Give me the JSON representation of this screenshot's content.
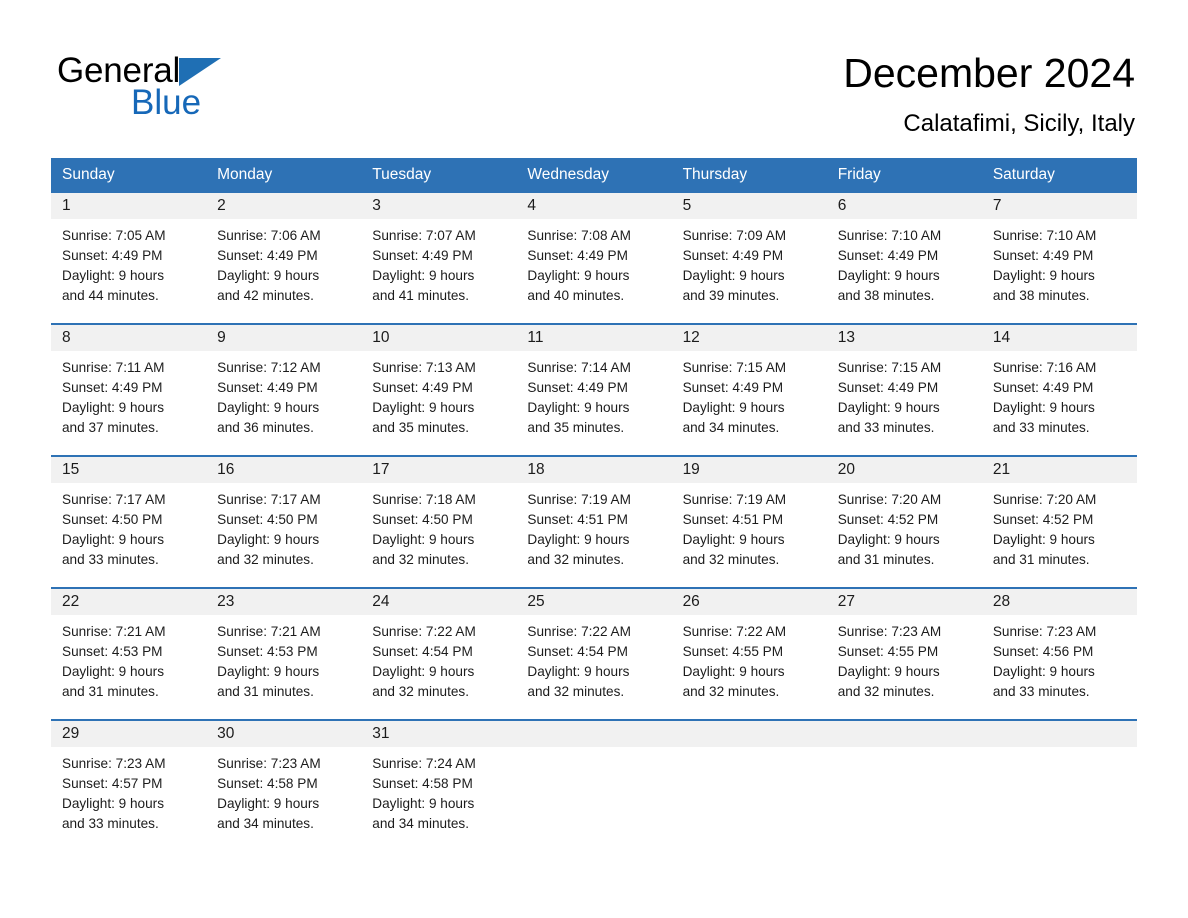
{
  "brand": {
    "name_part1": "General",
    "name_part2": "Blue",
    "accent_color": "#1668b8",
    "triangle_color": "#1f6fb4"
  },
  "header": {
    "title": "December 2024",
    "subtitle": "Calatafimi, Sicily, Italy",
    "header_bg_color": "#2e72b5",
    "day_band_color": "#f1f1f1"
  },
  "weekdays": [
    "Sunday",
    "Monday",
    "Tuesday",
    "Wednesday",
    "Thursday",
    "Friday",
    "Saturday"
  ],
  "weeks": [
    [
      {
        "day": "1",
        "sunrise": "Sunrise: 7:05 AM",
        "sunset": "Sunset: 4:49 PM",
        "daylight_line1": "Daylight: 9 hours",
        "daylight_line2": "and 44 minutes."
      },
      {
        "day": "2",
        "sunrise": "Sunrise: 7:06 AM",
        "sunset": "Sunset: 4:49 PM",
        "daylight_line1": "Daylight: 9 hours",
        "daylight_line2": "and 42 minutes."
      },
      {
        "day": "3",
        "sunrise": "Sunrise: 7:07 AM",
        "sunset": "Sunset: 4:49 PM",
        "daylight_line1": "Daylight: 9 hours",
        "daylight_line2": "and 41 minutes."
      },
      {
        "day": "4",
        "sunrise": "Sunrise: 7:08 AM",
        "sunset": "Sunset: 4:49 PM",
        "daylight_line1": "Daylight: 9 hours",
        "daylight_line2": "and 40 minutes."
      },
      {
        "day": "5",
        "sunrise": "Sunrise: 7:09 AM",
        "sunset": "Sunset: 4:49 PM",
        "daylight_line1": "Daylight: 9 hours",
        "daylight_line2": "and 39 minutes."
      },
      {
        "day": "6",
        "sunrise": "Sunrise: 7:10 AM",
        "sunset": "Sunset: 4:49 PM",
        "daylight_line1": "Daylight: 9 hours",
        "daylight_line2": "and 38 minutes."
      },
      {
        "day": "7",
        "sunrise": "Sunrise: 7:10 AM",
        "sunset": "Sunset: 4:49 PM",
        "daylight_line1": "Daylight: 9 hours",
        "daylight_line2": "and 38 minutes."
      }
    ],
    [
      {
        "day": "8",
        "sunrise": "Sunrise: 7:11 AM",
        "sunset": "Sunset: 4:49 PM",
        "daylight_line1": "Daylight: 9 hours",
        "daylight_line2": "and 37 minutes."
      },
      {
        "day": "9",
        "sunrise": "Sunrise: 7:12 AM",
        "sunset": "Sunset: 4:49 PM",
        "daylight_line1": "Daylight: 9 hours",
        "daylight_line2": "and 36 minutes."
      },
      {
        "day": "10",
        "sunrise": "Sunrise: 7:13 AM",
        "sunset": "Sunset: 4:49 PM",
        "daylight_line1": "Daylight: 9 hours",
        "daylight_line2": "and 35 minutes."
      },
      {
        "day": "11",
        "sunrise": "Sunrise: 7:14 AM",
        "sunset": "Sunset: 4:49 PM",
        "daylight_line1": "Daylight: 9 hours",
        "daylight_line2": "and 35 minutes."
      },
      {
        "day": "12",
        "sunrise": "Sunrise: 7:15 AM",
        "sunset": "Sunset: 4:49 PM",
        "daylight_line1": "Daylight: 9 hours",
        "daylight_line2": "and 34 minutes."
      },
      {
        "day": "13",
        "sunrise": "Sunrise: 7:15 AM",
        "sunset": "Sunset: 4:49 PM",
        "daylight_line1": "Daylight: 9 hours",
        "daylight_line2": "and 33 minutes."
      },
      {
        "day": "14",
        "sunrise": "Sunrise: 7:16 AM",
        "sunset": "Sunset: 4:49 PM",
        "daylight_line1": "Daylight: 9 hours",
        "daylight_line2": "and 33 minutes."
      }
    ],
    [
      {
        "day": "15",
        "sunrise": "Sunrise: 7:17 AM",
        "sunset": "Sunset: 4:50 PM",
        "daylight_line1": "Daylight: 9 hours",
        "daylight_line2": "and 33 minutes."
      },
      {
        "day": "16",
        "sunrise": "Sunrise: 7:17 AM",
        "sunset": "Sunset: 4:50 PM",
        "daylight_line1": "Daylight: 9 hours",
        "daylight_line2": "and 32 minutes."
      },
      {
        "day": "17",
        "sunrise": "Sunrise: 7:18 AM",
        "sunset": "Sunset: 4:50 PM",
        "daylight_line1": "Daylight: 9 hours",
        "daylight_line2": "and 32 minutes."
      },
      {
        "day": "18",
        "sunrise": "Sunrise: 7:19 AM",
        "sunset": "Sunset: 4:51 PM",
        "daylight_line1": "Daylight: 9 hours",
        "daylight_line2": "and 32 minutes."
      },
      {
        "day": "19",
        "sunrise": "Sunrise: 7:19 AM",
        "sunset": "Sunset: 4:51 PM",
        "daylight_line1": "Daylight: 9 hours",
        "daylight_line2": "and 32 minutes."
      },
      {
        "day": "20",
        "sunrise": "Sunrise: 7:20 AM",
        "sunset": "Sunset: 4:52 PM",
        "daylight_line1": "Daylight: 9 hours",
        "daylight_line2": "and 31 minutes."
      },
      {
        "day": "21",
        "sunrise": "Sunrise: 7:20 AM",
        "sunset": "Sunset: 4:52 PM",
        "daylight_line1": "Daylight: 9 hours",
        "daylight_line2": "and 31 minutes."
      }
    ],
    [
      {
        "day": "22",
        "sunrise": "Sunrise: 7:21 AM",
        "sunset": "Sunset: 4:53 PM",
        "daylight_line1": "Daylight: 9 hours",
        "daylight_line2": "and 31 minutes."
      },
      {
        "day": "23",
        "sunrise": "Sunrise: 7:21 AM",
        "sunset": "Sunset: 4:53 PM",
        "daylight_line1": "Daylight: 9 hours",
        "daylight_line2": "and 31 minutes."
      },
      {
        "day": "24",
        "sunrise": "Sunrise: 7:22 AM",
        "sunset": "Sunset: 4:54 PM",
        "daylight_line1": "Daylight: 9 hours",
        "daylight_line2": "and 32 minutes."
      },
      {
        "day": "25",
        "sunrise": "Sunrise: 7:22 AM",
        "sunset": "Sunset: 4:54 PM",
        "daylight_line1": "Daylight: 9 hours",
        "daylight_line2": "and 32 minutes."
      },
      {
        "day": "26",
        "sunrise": "Sunrise: 7:22 AM",
        "sunset": "Sunset: 4:55 PM",
        "daylight_line1": "Daylight: 9 hours",
        "daylight_line2": "and 32 minutes."
      },
      {
        "day": "27",
        "sunrise": "Sunrise: 7:23 AM",
        "sunset": "Sunset: 4:55 PM",
        "daylight_line1": "Daylight: 9 hours",
        "daylight_line2": "and 32 minutes."
      },
      {
        "day": "28",
        "sunrise": "Sunrise: 7:23 AM",
        "sunset": "Sunset: 4:56 PM",
        "daylight_line1": "Daylight: 9 hours",
        "daylight_line2": "and 33 minutes."
      }
    ],
    [
      {
        "day": "29",
        "sunrise": "Sunrise: 7:23 AM",
        "sunset": "Sunset: 4:57 PM",
        "daylight_line1": "Daylight: 9 hours",
        "daylight_line2": "and 33 minutes."
      },
      {
        "day": "30",
        "sunrise": "Sunrise: 7:23 AM",
        "sunset": "Sunset: 4:58 PM",
        "daylight_line1": "Daylight: 9 hours",
        "daylight_line2": "and 34 minutes."
      },
      {
        "day": "31",
        "sunrise": "Sunrise: 7:24 AM",
        "sunset": "Sunset: 4:58 PM",
        "daylight_line1": "Daylight: 9 hours",
        "daylight_line2": "and 34 minutes."
      },
      {
        "day": "",
        "sunrise": "",
        "sunset": "",
        "daylight_line1": "",
        "daylight_line2": ""
      },
      {
        "day": "",
        "sunrise": "",
        "sunset": "",
        "daylight_line1": "",
        "daylight_line2": ""
      },
      {
        "day": "",
        "sunrise": "",
        "sunset": "",
        "daylight_line1": "",
        "daylight_line2": ""
      },
      {
        "day": "",
        "sunrise": "",
        "sunset": "",
        "daylight_line1": "",
        "daylight_line2": ""
      }
    ]
  ]
}
